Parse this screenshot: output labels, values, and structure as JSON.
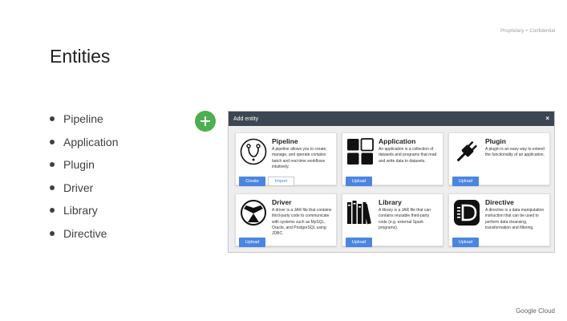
{
  "header": {
    "confidential": "Proprietary + Confidential"
  },
  "slide": {
    "title": "Entities"
  },
  "bullets": [
    "Pipeline",
    "Application",
    "Plugin",
    "Driver",
    "Library",
    "Directive"
  ],
  "plus_button": {
    "icon": "plus-icon",
    "color": "#4caf50"
  },
  "modal": {
    "title": "Add entity",
    "close": "×",
    "cards": [
      {
        "name": "Pipeline",
        "icon": "pipeline-icon",
        "desc": "A pipeline allows you to create, manage, and operate complex batch and real-time workflows intuitively.",
        "buttons": [
          "Create",
          "Import"
        ]
      },
      {
        "name": "Application",
        "icon": "application-icon",
        "desc": "An application is a collection of datasets and programs that read and write data to datasets.",
        "buttons": [
          "Upload"
        ]
      },
      {
        "name": "Plugin",
        "icon": "plug-icon",
        "desc": "A plugin is an easy way to extend the functionality of an application.",
        "buttons": [
          "Upload"
        ]
      },
      {
        "name": "Driver",
        "icon": "driver-icon",
        "desc": "A driver is a JAR file that contains third-party code to communicate with systems such as MySQL, Oracle, and PostgreSQL using JDBC.",
        "buttons": [
          "Upload"
        ]
      },
      {
        "name": "Library",
        "icon": "library-icon",
        "desc": "A library is a JAR file that can contains reusable third-party code (e.g. external Spark programs).",
        "buttons": [
          "Upload"
        ]
      },
      {
        "name": "Directive",
        "icon": "directive-icon",
        "desc": "A directive is a data manipulation instruction that can be used to perform data cleansing, transformation and filtering.",
        "buttons": [
          "Upload"
        ]
      }
    ]
  },
  "footer": {
    "brand": "Google Cloud"
  },
  "colors": {
    "header_bg": "#3d4653",
    "button_blue": "#4a86e0",
    "accent_green": "#4caf50"
  }
}
